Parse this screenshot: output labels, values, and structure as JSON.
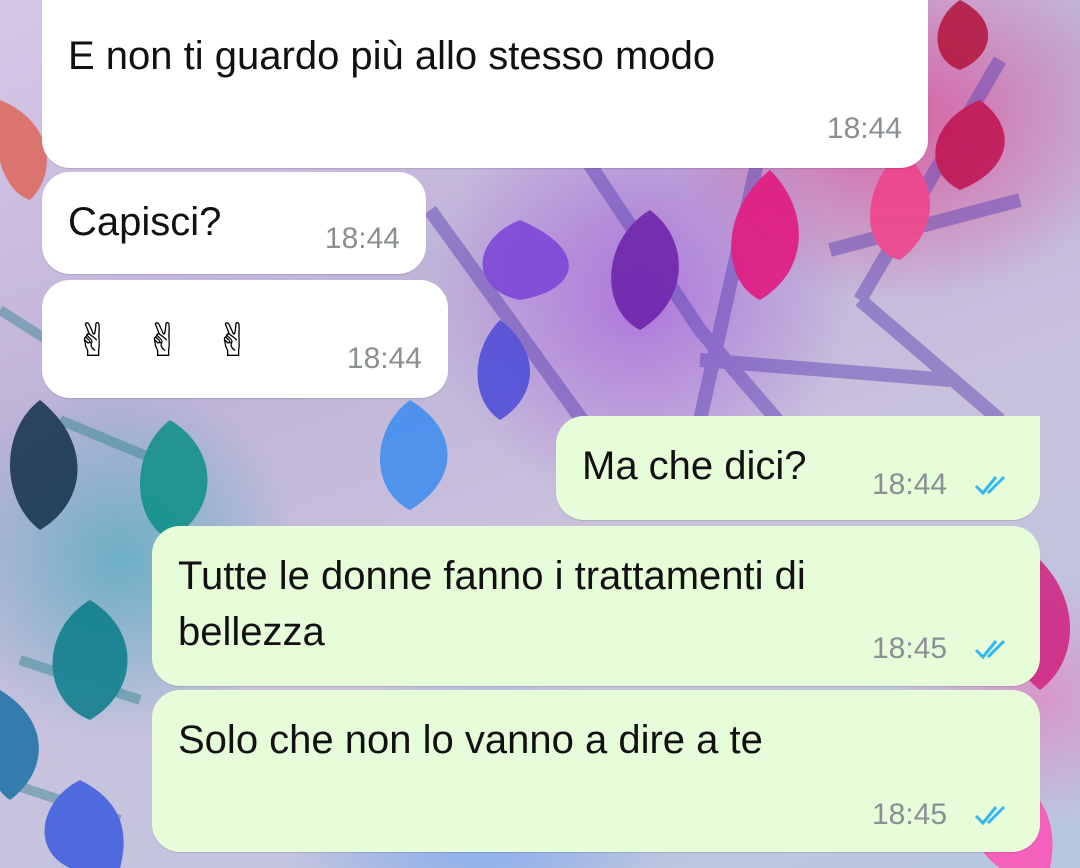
{
  "colors": {
    "incoming_bubble": "#ffffff",
    "outgoing_bubble": "#e7fcd9",
    "read_ticks": "#34b7f1",
    "timestamp": "#8a8f93"
  },
  "messages": [
    {
      "direction": "incoming",
      "text": "E non ti guardo più allo stesso modo",
      "time": "18:44"
    },
    {
      "direction": "incoming",
      "text": "Capisci?",
      "time": "18:44"
    },
    {
      "direction": "incoming",
      "text": "✌️✌️✌️",
      "time": "18:44",
      "emoji_icons": [
        "victory-hand-icon",
        "victory-hand-icon",
        "victory-hand-icon"
      ]
    },
    {
      "direction": "outgoing",
      "text": "Ma che dici?",
      "time": "18:44",
      "status": "read"
    },
    {
      "direction": "outgoing",
      "text": "Tutte le donne fanno i trattamenti di\nbellezza",
      "time": "18:45",
      "status": "read"
    },
    {
      "direction": "outgoing",
      "text": "Solo che non lo vanno a dire a te",
      "time": "18:45",
      "status": "read"
    }
  ]
}
